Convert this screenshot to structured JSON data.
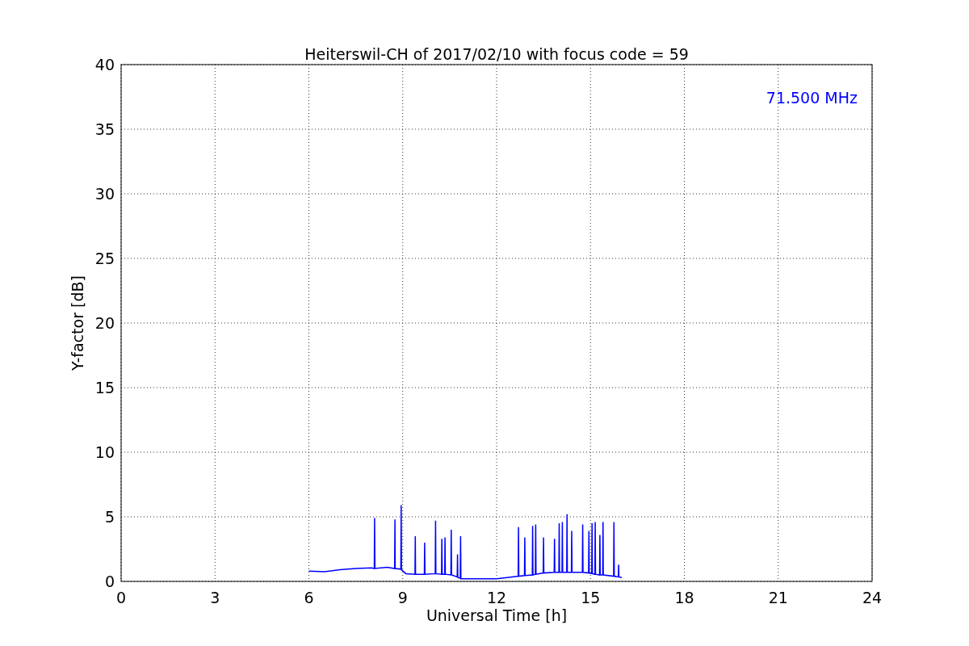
{
  "figure": {
    "chart_data": {
      "type": "line",
      "title": "Heiterswil-CH of 2017/02/10 with focus code = 59",
      "xlabel": "Universal Time [h]",
      "ylabel": "Y-factor [dB]",
      "xlim": [
        0,
        24
      ],
      "ylim": [
        0,
        40
      ],
      "xticks": [
        0,
        3,
        6,
        9,
        12,
        15,
        18,
        21,
        24
      ],
      "yticks": [
        0,
        5,
        10,
        15,
        20,
        25,
        30,
        35,
        40
      ],
      "x": [
        6.0,
        6.5,
        7.0,
        7.5,
        8.0,
        8.09,
        8.1,
        8.11,
        8.5,
        8.74,
        8.75,
        8.76,
        8.94,
        8.95,
        8.96,
        9.1,
        9.39,
        9.4,
        9.41,
        9.69,
        9.7,
        9.71,
        10.04,
        10.05,
        10.06,
        10.24,
        10.25,
        10.26,
        10.34,
        10.35,
        10.36,
        10.54,
        10.55,
        10.56,
        10.74,
        10.75,
        10.76,
        10.84,
        10.85,
        10.86,
        11.5,
        12.0,
        12.5,
        12.69,
        12.7,
        12.71,
        12.89,
        12.9,
        12.91,
        13.14,
        13.15,
        13.16,
        13.24,
        13.25,
        13.26,
        13.49,
        13.5,
        13.51,
        13.84,
        13.85,
        13.86,
        13.99,
        14.0,
        14.01,
        14.09,
        14.1,
        14.11,
        14.24,
        14.25,
        14.26,
        14.39,
        14.4,
        14.41,
        14.74,
        14.75,
        14.76,
        14.94,
        14.95,
        14.96,
        15.04,
        15.05,
        15.06,
        15.14,
        15.15,
        15.16,
        15.29,
        15.3,
        15.31,
        15.39,
        15.4,
        15.41,
        15.74,
        15.75,
        15.76,
        15.89,
        15.9,
        15.91,
        16.0
      ],
      "series": [
        {
          "name": "71.500 MHz",
          "color": "#0000ff",
          "values": [
            0.8,
            0.75,
            0.9,
            1.0,
            1.05,
            1.0,
            4.9,
            1.0,
            1.1,
            1.0,
            4.8,
            1.0,
            0.95,
            5.9,
            0.9,
            0.6,
            0.55,
            3.5,
            0.55,
            0.55,
            3.0,
            0.55,
            0.6,
            4.7,
            0.6,
            0.55,
            3.3,
            0.55,
            0.55,
            3.4,
            0.55,
            0.5,
            4.0,
            0.5,
            0.35,
            2.1,
            0.3,
            0.25,
            3.5,
            0.2,
            0.2,
            0.2,
            0.35,
            0.4,
            4.2,
            0.4,
            0.45,
            3.4,
            0.45,
            0.5,
            4.3,
            0.5,
            0.55,
            4.4,
            0.55,
            0.65,
            3.4,
            0.65,
            0.7,
            3.3,
            0.7,
            0.7,
            4.5,
            0.7,
            0.7,
            4.6,
            0.7,
            0.7,
            5.2,
            0.7,
            0.7,
            3.9,
            0.7,
            0.7,
            4.4,
            0.7,
            0.65,
            3.9,
            0.65,
            0.6,
            4.5,
            0.6,
            0.55,
            4.6,
            0.55,
            0.5,
            3.6,
            0.5,
            0.5,
            4.6,
            0.5,
            0.4,
            4.6,
            0.4,
            0.35,
            1.3,
            0.35,
            0.3
          ]
        }
      ],
      "grid": true
    }
  }
}
